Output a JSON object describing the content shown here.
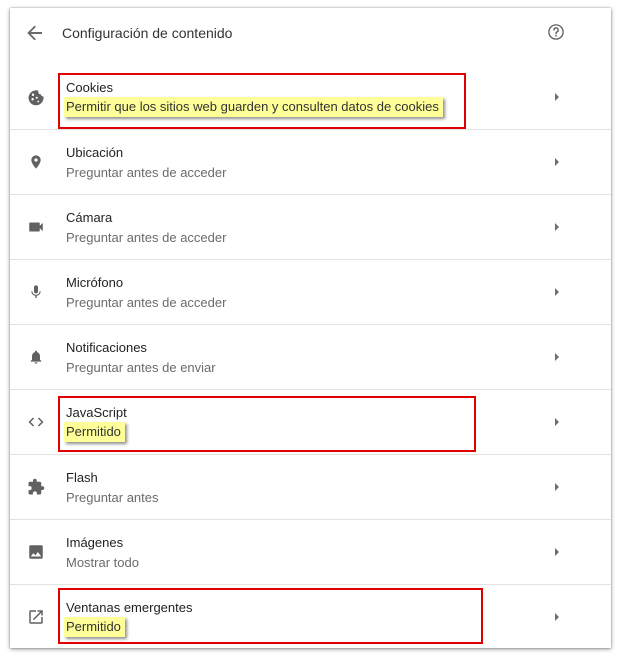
{
  "header": {
    "title": "Configuración de contenido",
    "back_icon": "arrow-back-icon",
    "help_icon": "help-circle-icon"
  },
  "colors": {
    "highlight": "#ffff9a",
    "annotation_box": "#e00000",
    "icon": "#616161"
  },
  "rows": [
    {
      "id": "cookies",
      "label": "Cookies",
      "sub": "Permitir que los sitios web guarden y consulten datos de cookies",
      "icon": "cookie-icon",
      "highlighted": true
    },
    {
      "id": "ubicacion",
      "label": "Ubicación",
      "sub": "Preguntar antes de acceder",
      "icon": "location-pin-icon",
      "highlighted": false
    },
    {
      "id": "camara",
      "label": "Cámara",
      "sub": "Preguntar antes de acceder",
      "icon": "videocam-icon",
      "highlighted": false
    },
    {
      "id": "microfono",
      "label": "Micrófono",
      "sub": "Preguntar antes de acceder",
      "icon": "microphone-icon",
      "highlighted": false
    },
    {
      "id": "notificaciones",
      "label": "Notificaciones",
      "sub": "Preguntar antes de enviar",
      "icon": "bell-icon",
      "highlighted": false
    },
    {
      "id": "javascript",
      "label": "JavaScript",
      "sub": "Permitido",
      "icon": "code-icon",
      "highlighted": true
    },
    {
      "id": "flash",
      "label": "Flash",
      "sub": "Preguntar antes",
      "icon": "puzzle-icon",
      "highlighted": false
    },
    {
      "id": "imagenes",
      "label": "Imágenes",
      "sub": "Mostrar todo",
      "icon": "image-icon",
      "highlighted": false
    },
    {
      "id": "ventanas",
      "label": "Ventanas emergentes",
      "sub": "Permitido",
      "icon": "open-in-new-icon",
      "highlighted": true
    }
  ]
}
